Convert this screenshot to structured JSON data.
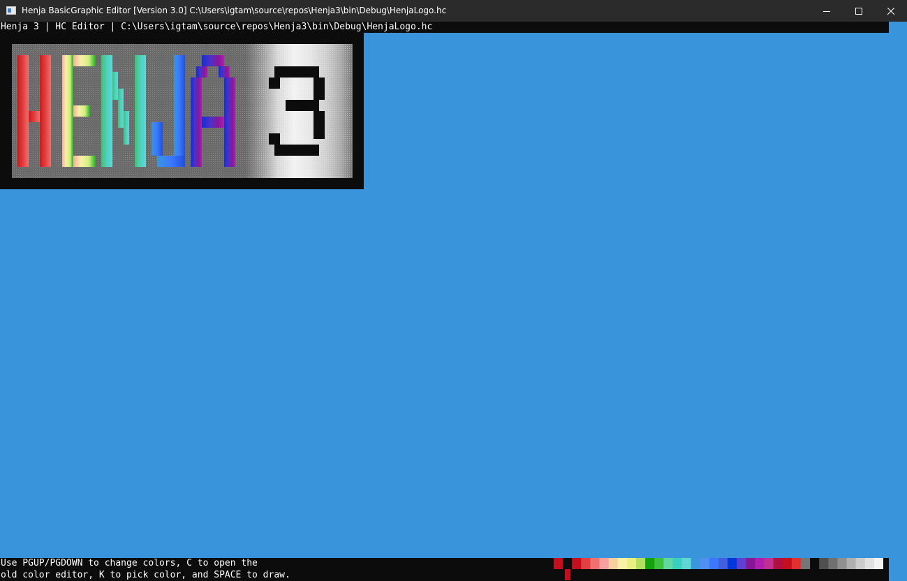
{
  "window": {
    "title": "Henja BasicGraphic Editor [Version 3.0] C:\\Users\\igtam\\source\\repos\\Henja3\\bin\\Debug\\HenjaLogo.hc",
    "controls": {
      "minimize": "minimize-icon",
      "maximize": "maximize-icon",
      "close": "close-icon"
    }
  },
  "console": {
    "header": "Henja 3 | HC Editor | C:\\Users\\igtam\\source\\repos\\Henja3\\bin\\Debug\\HenjaLogo.hc",
    "help_line_1": "Use PGUP/PGDOWN to change colors, C to open the",
    "help_line_2": "old color editor, K to pick color, and SPACE to draw."
  },
  "artwork": {
    "subject": "HENJA 3 pixel-art logo",
    "letters": [
      "H",
      "E",
      "N",
      "J",
      "A",
      "3"
    ]
  },
  "palette": {
    "colors": [
      "#c50f1f",
      "#0c0c0c",
      "#c50f1f",
      "#e04040",
      "#f07070",
      "#f6a0a0",
      "#f8d0a0",
      "#f9f1a5",
      "#e8f080",
      "#b0e060",
      "#13a10e",
      "#40c040",
      "#60d8a0",
      "#3ad0c0",
      "#61d6d6",
      "#3a96dd",
      "#5090f0",
      "#3b78ff",
      "#4060e0",
      "#0037da",
      "#6040d0",
      "#881798",
      "#b020b0",
      "#c03090",
      "#b01040",
      "#c50f1f",
      "#e03030",
      "#767676",
      "#0c0c0c",
      "#505050",
      "#707070",
      "#909090",
      "#b0b0b0",
      "#cccccc",
      "#e0e0e0",
      "#f2f2f2"
    ],
    "selected_index": 2,
    "accent": "#c50f1f"
  },
  "colors": {
    "background": "#3a94dc",
    "console": "#0c0c0c",
    "titlebar": "#2b2b2b"
  }
}
